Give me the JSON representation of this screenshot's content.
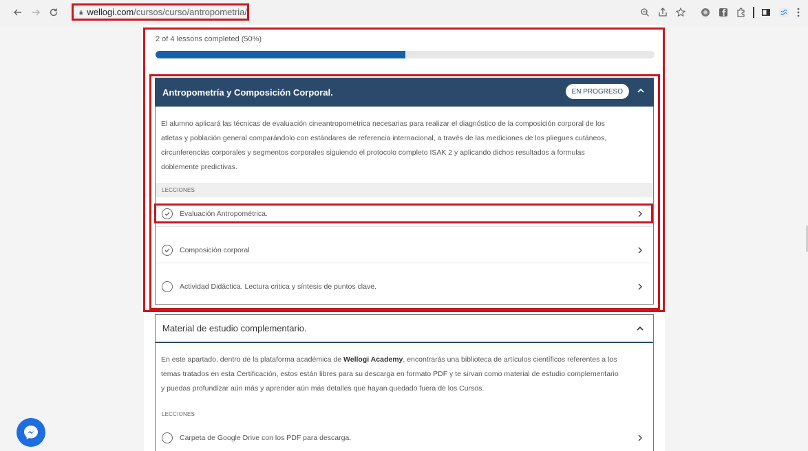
{
  "browser": {
    "url_host": "wellogi.com",
    "url_path": "/cursos/curso/antropometria/"
  },
  "progress": {
    "text": "2 of 4 lessons completed (50%)",
    "fraction": 0.5
  },
  "section1": {
    "title": "Antropometría y Composición Corporal.",
    "badge": "EN PROGRESO",
    "desc_lines": [
      "El alumno aplicará las técnicas de evaluación cineantropometrica necesarias para realizar el diagnóstico de la composición corporal de los",
      "atletas y población general comparándolo con estándares de referencia internacional, a través de las mediciones de los pliegues cutáneos,",
      "circunferencias corporales y segmentos corporales siguiendo el protocolo completo ISAK 2 y aplicando dichos resultados a formulas",
      "doblemente predictivas."
    ],
    "lecciones_label": "LECCIONES",
    "lessons": [
      {
        "label": "Evaluación Antropométrica.",
        "completed": true
      },
      {
        "label": "Composición corporal",
        "completed": true
      },
      {
        "label": "Actividad Didáctica. Lectura critica y síntesis de puntos clave.",
        "completed": false
      }
    ]
  },
  "section2": {
    "title": "Material de estudio complementario.",
    "desc_line1_pre": "En este apartado, dentro de la plataforma académica de ",
    "desc_line1_bold": "Wellogi Academy",
    "desc_line1_post": ", encontrarás una biblioteca de artículos científicos referentes a los",
    "desc_line2": "temas tratados en esta Certificación, estos están libres para su descarga en formato PDF y te sirvan como material de estudio complementario",
    "desc_line3": "y puedas profundizar aún más y aprender aún más detalles que hayan quedado fuera de los Cursos.",
    "lecciones_label": "LECCIONES",
    "lessons": [
      {
        "label": "Carpeta de Google Drive con los PDF para descarga.",
        "completed": false
      }
    ]
  },
  "colors": {
    "accent": "#2b4a6b",
    "progress": "#1860a8",
    "highlight": "#c8171e",
    "messenger": "#1e6ee0"
  }
}
